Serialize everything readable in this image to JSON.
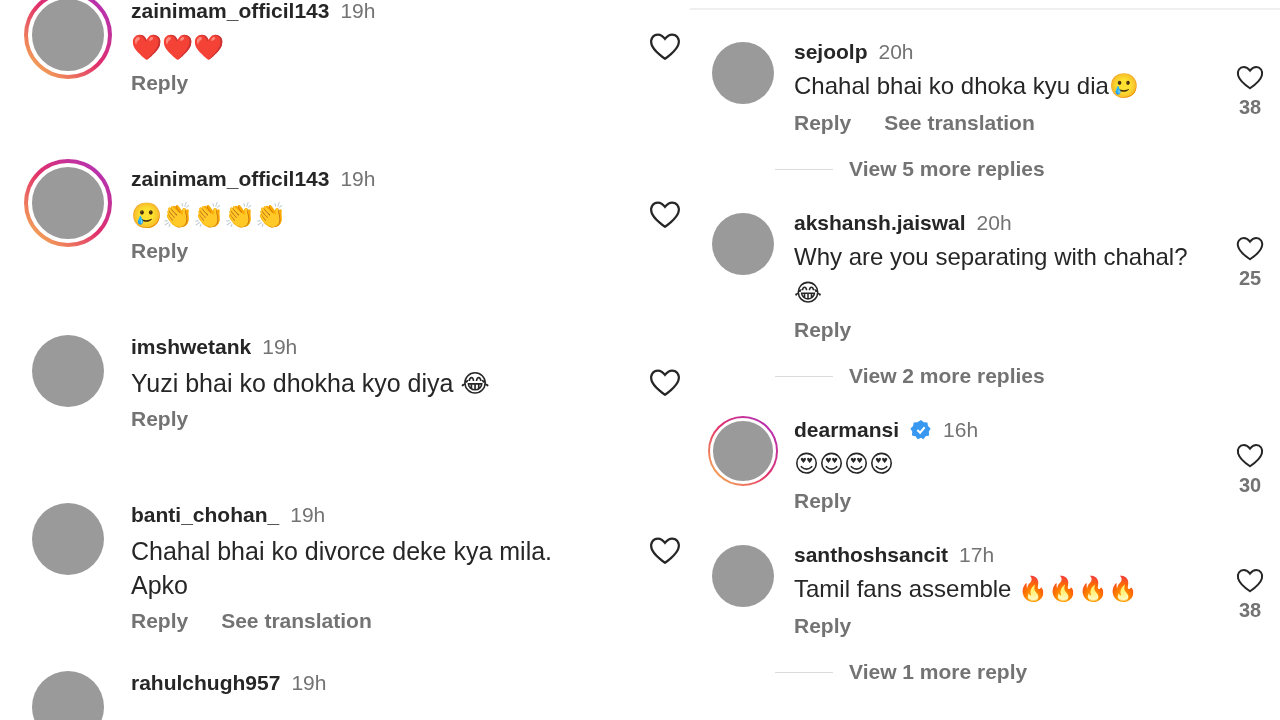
{
  "left_column": {
    "comments": [
      {
        "username": "zainimam_officil143",
        "time": "19h",
        "text": "❤️❤️❤️",
        "story_ring": true,
        "verified": false,
        "liked": false,
        "actions": [
          "Reply"
        ]
      },
      {
        "username": "zainimam_officil143",
        "time": "19h",
        "text": "🥲👏👏👏👏",
        "story_ring": true,
        "verified": false,
        "liked": false,
        "actions": [
          "Reply"
        ]
      },
      {
        "username": "imshwetank",
        "time": "19h",
        "text": "Yuzi bhai ko dhokha kyo diya 😂",
        "story_ring": false,
        "verified": false,
        "liked": false,
        "actions": [
          "Reply"
        ]
      },
      {
        "username": "banti_chohan_",
        "time": "19h",
        "text": "Chahal bhai ko divorce deke kya mila. Apko",
        "story_ring": false,
        "verified": false,
        "liked": false,
        "actions": [
          "Reply",
          "See translation"
        ]
      },
      {
        "username": "rahulchugh957",
        "time": "19h",
        "story_ring": false,
        "verified": false
      }
    ]
  },
  "right_column": {
    "items": [
      {
        "kind": "comment",
        "username": "sejoolp",
        "time": "20h",
        "text": "Chahal bhai ko dhoka kyu dia🥲",
        "story_ring": false,
        "verified": false,
        "liked": false,
        "likes": "38",
        "actions": [
          "Reply",
          "See translation"
        ]
      },
      {
        "kind": "more_replies",
        "label": "View 5 more replies"
      },
      {
        "kind": "comment",
        "username": "akshansh.jaiswal",
        "time": "20h",
        "text": "Why are you separating with chahal? 😂",
        "story_ring": false,
        "verified": false,
        "liked": false,
        "likes": "25",
        "actions": [
          "Reply"
        ]
      },
      {
        "kind": "more_replies",
        "label": "View 2 more replies"
      },
      {
        "kind": "comment",
        "username": "dearmansi",
        "time": "16h",
        "text": "😍😍😍😍",
        "story_ring": true,
        "verified": true,
        "liked": false,
        "likes": "30",
        "actions": [
          "Reply"
        ]
      },
      {
        "kind": "comment",
        "username": "santhoshsancit",
        "time": "17h",
        "text": "Tamil fans assemble 🔥🔥🔥🔥",
        "story_ring": false,
        "verified": false,
        "liked": false,
        "likes": "38",
        "actions": [
          "Reply"
        ]
      },
      {
        "kind": "more_replies",
        "label": "View 1 more reply"
      }
    ]
  }
}
